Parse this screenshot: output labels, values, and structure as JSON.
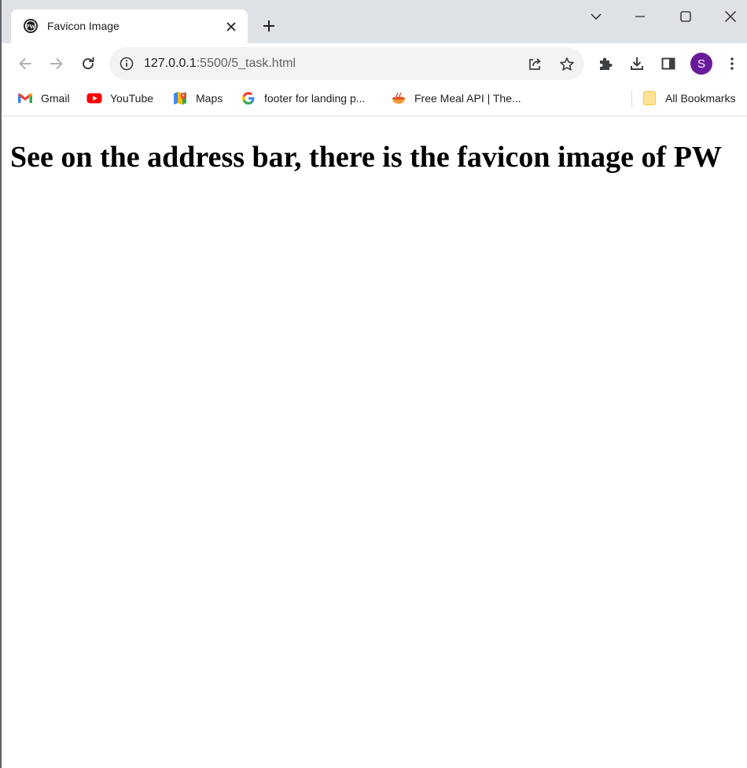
{
  "tab": {
    "title": "Favicon Image",
    "favicon": "pw-logo-icon"
  },
  "address_bar": {
    "url_host": "127.0.0.1",
    "url_rest": ":5500/5_task.html"
  },
  "profile": {
    "initial": "S",
    "color": "#6a1b9a"
  },
  "bookmarks": [
    {
      "label": "Gmail",
      "icon": "gmail-icon"
    },
    {
      "label": "YouTube",
      "icon": "youtube-icon"
    },
    {
      "label": "Maps",
      "icon": "maps-icon"
    },
    {
      "label": "footer for landing p...",
      "icon": "google-icon"
    },
    {
      "label": "Free Meal API | The...",
      "icon": "meal-icon"
    }
  ],
  "all_bookmarks": {
    "label": "All Bookmarks",
    "icon": "folder-icon"
  },
  "page": {
    "heading": "See on the address bar, there is the favicon image of PW"
  }
}
